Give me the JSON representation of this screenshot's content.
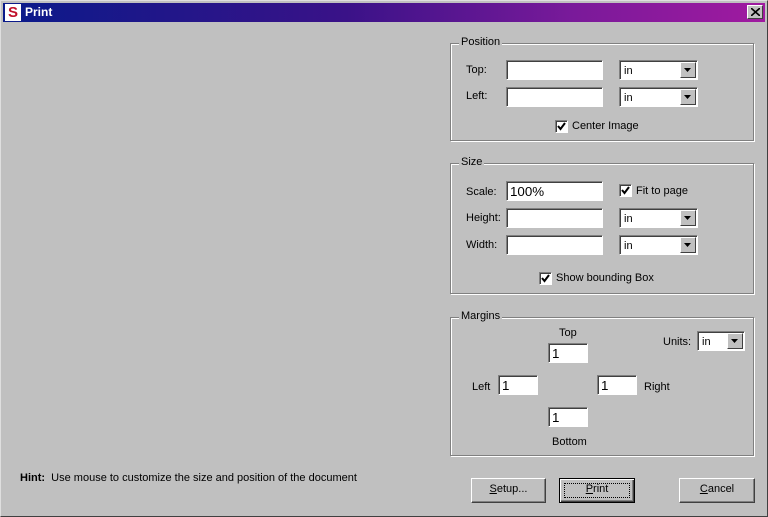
{
  "window": {
    "title": "Print",
    "app_icon_letter": "S"
  },
  "position": {
    "legend": "Position",
    "top_label": "Top:",
    "top_value": "",
    "top_unit": "in",
    "left_label": "Left:",
    "left_value": "",
    "left_unit": "in",
    "center_image_label": "Center Image",
    "center_image_checked": true
  },
  "size": {
    "legend": "Size",
    "scale_label": "Scale:",
    "scale_value": "100%",
    "fit_to_page_label": "Fit to page",
    "fit_to_page_checked": true,
    "height_label": "Height:",
    "height_value": "",
    "height_unit": "in",
    "width_label": "Width:",
    "width_value": "",
    "width_unit": "in",
    "show_bounding_box_label": "Show bounding Box",
    "show_bounding_box_checked": true
  },
  "margins": {
    "legend": "Margins",
    "top_label": "Top",
    "top_value": "1",
    "left_label": "Left",
    "left_value": "1",
    "right_label": "Right",
    "right_value": "1",
    "bottom_label": "Bottom",
    "bottom_value": "1",
    "units_label": "Units:",
    "units_value": "in"
  },
  "hint": {
    "label": "Hint:",
    "text": "Use mouse to customize the size and position of the document"
  },
  "buttons": {
    "setup_mnemonic": "S",
    "setup_rest": "etup...",
    "print_mnemonic": "P",
    "print_rest": "rint",
    "cancel_mnemonic": "C",
    "cancel_rest": "ancel"
  },
  "icons": {
    "close": "close-icon",
    "dropdown": "chevron-down-icon",
    "check": "checkmark-icon"
  }
}
